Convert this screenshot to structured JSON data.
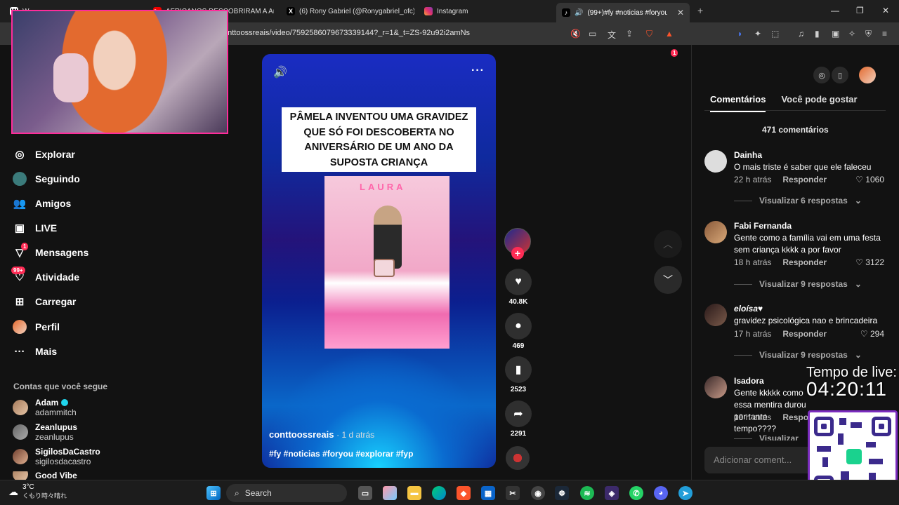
{
  "browser": {
    "tabs": [
      {
        "label": "W"
      },
      {
        "label": "AFRICANOS DESCOBRIRAM A Am"
      },
      {
        "label": "(6) Rony Gabriel (@Ronygabriel_ofc)"
      },
      {
        "label": "Instagram"
      },
      {
        "label": "(99+)#fy #noticias #foryou #"
      }
    ],
    "url": "onttoossreais/video/7592586079673339144?_r=1&_t=ZS-92u92i2amNs",
    "extension_badge": "1"
  },
  "sidebar": {
    "items": [
      {
        "label": "Explorar",
        "icon": "compass-icon"
      },
      {
        "label": "Seguindo",
        "icon": "following-icon"
      },
      {
        "label": "Amigos",
        "icon": "friends-icon"
      },
      {
        "label": "LIVE",
        "icon": "live-icon"
      },
      {
        "label": "Mensagens",
        "icon": "messages-icon",
        "badge": "1"
      },
      {
        "label": "Atividade",
        "icon": "activity-icon",
        "badge": "99+"
      },
      {
        "label": "Carregar",
        "icon": "upload-icon"
      },
      {
        "label": "Perfil",
        "icon": "profile-avatar"
      },
      {
        "label": "Mais",
        "icon": "more-icon"
      }
    ],
    "following_title": "Contas que você segue",
    "following": [
      {
        "name": "Adam",
        "user": "adammitch",
        "verified": true
      },
      {
        "name": "Zeanlupus",
        "user": "zeanlupus"
      },
      {
        "name": "SigilosDaCastro",
        "user": "sigilosdacastro"
      },
      {
        "name": "Good Vibe",
        "user": ""
      }
    ]
  },
  "video": {
    "banner": "PÂMELA INVENTOU UMA GRAVIDEZ QUE SÓ FOI DESCOBERTA NO ANIVERSÁRIO DE UM ANO DA SUPOSTA CRIANÇA",
    "photo_text": "LAURA",
    "author": "conttoossreais",
    "time": "· 1 d atrás",
    "tags": "#fy #noticias #foryou #explorar #fyp"
  },
  "actions": {
    "likes": "40.8K",
    "comments": "469",
    "saves": "2523",
    "shares": "2291"
  },
  "panel": {
    "tab_comments": "Comentários",
    "tab_suggest": "Você pode gostar",
    "count": "471 comentários",
    "comments": [
      {
        "name": "Dainha",
        "text": "O mais triste é saber que ele faleceu",
        "time": "22 h atrás",
        "reply": "Responder",
        "likes": "1060",
        "more": "Visualizar 6 respostas"
      },
      {
        "name": "Fabi Fernanda",
        "text": "Gente como a família vai em uma festa sem criança kkkk a por favor",
        "time": "18 h atrás",
        "reply": "Responder",
        "likes": "3122",
        "more": "Visualizar 9 respostas"
      },
      {
        "name": "eloísa♥",
        "text": "gravidez psicológica nao e brincadeira",
        "time": "17 h atrás",
        "reply": "Responder",
        "likes": "294",
        "more": "Visualizar 9 respostas"
      },
      {
        "name": "Isadora",
        "text": "Gente kkkkk como essa mentira durou por tanto tempo????",
        "time": "18 h atrás",
        "reply": "Respo",
        "likes": "",
        "more": "Visualizar"
      }
    ],
    "add_placeholder": "Adicionar coment..."
  },
  "overlay": {
    "live_label": "Tempo de live:",
    "live_time": "04:20:11"
  },
  "taskbar": {
    "temp": "3°C",
    "condition": "くもり時々晴れ",
    "search": "Search"
  }
}
